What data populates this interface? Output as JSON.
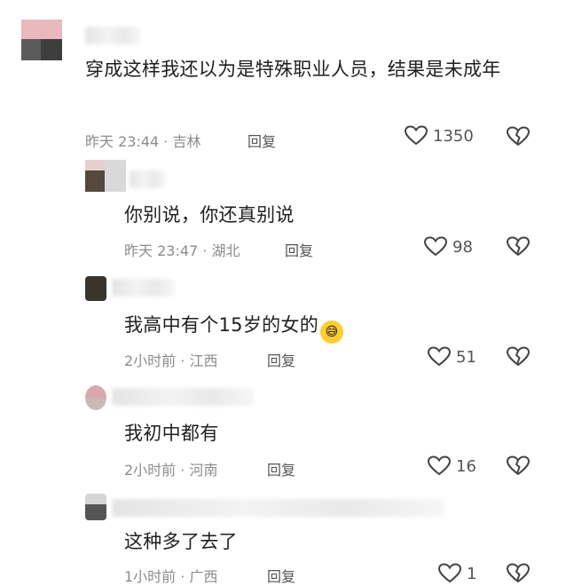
{
  "comments": [
    {
      "text": "穿成这样我还以为是特殊职业人员，结果是未成年",
      "time_location": "昨天 23:44 · 吉林",
      "reply": "回复",
      "likes": "1350"
    },
    {
      "text": "你别说，你还真别说",
      "time_location": "昨天 23:47 · 湖北",
      "reply": "回复",
      "likes": "98"
    },
    {
      "text": "我高中有个15岁的女的",
      "emoji": "😅",
      "time_location": "2小时前 · 江西",
      "reply": "回复",
      "likes": "51"
    },
    {
      "text": "我初中都有",
      "time_location": "2小时前 · 河南",
      "reply": "回复",
      "likes": "16"
    },
    {
      "text": "这种多了去了",
      "time_location": "1小时前 · 广西",
      "reply": "回复",
      "likes": "1"
    }
  ],
  "icons": {
    "like": "heart-icon",
    "dislike": "broken-heart-icon"
  },
  "colors": {
    "text": "#1f1f1f",
    "meta": "#8c8c8c",
    "icon": "#444444"
  }
}
